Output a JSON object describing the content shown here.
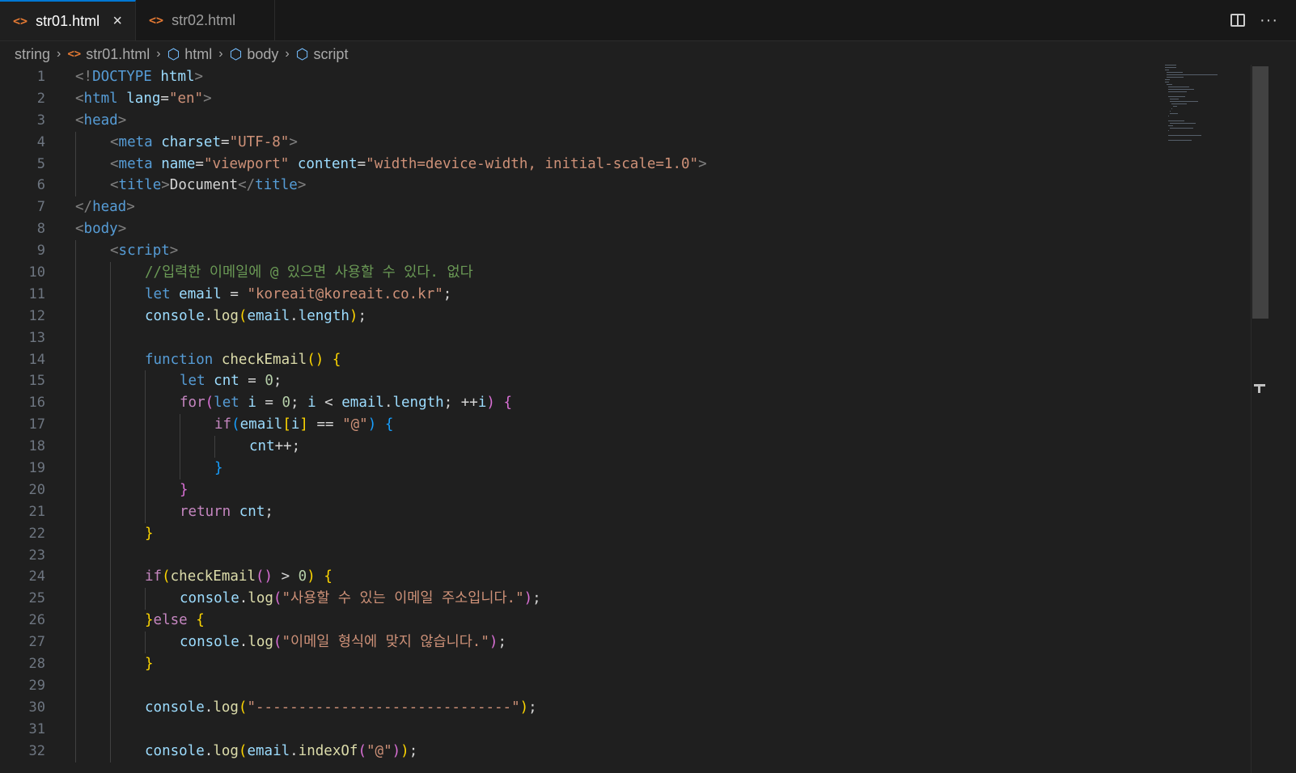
{
  "tabs": [
    {
      "label": "str01.html",
      "active": true,
      "icon": "html-file-icon"
    },
    {
      "label": "str02.html",
      "active": false,
      "icon": "html-file-icon"
    }
  ],
  "breadcrumb": [
    "string",
    "str01.html",
    "html",
    "body",
    "script"
  ],
  "icons": {
    "file": "<>",
    "close": "×",
    "chevron": "›",
    "symbol": "⬡",
    "more": "···"
  },
  "colors": {
    "background": "#1f1f1f",
    "tab_accent": "#0078d4",
    "html_icon": "#e37933",
    "symbol_icon": "#75beff"
  },
  "lines": [
    {
      "n": "1",
      "indent": 0,
      "t": [
        [
          "t-tag",
          "<!"
        ],
        [
          "t-el",
          "DOCTYPE"
        ],
        [
          "t-txt",
          " "
        ],
        [
          "t-at",
          "html"
        ],
        [
          "t-tag",
          ">"
        ]
      ]
    },
    {
      "n": "2",
      "indent": 0,
      "t": [
        [
          "t-tag",
          "<"
        ],
        [
          "t-el",
          "html"
        ],
        [
          "t-txt",
          " "
        ],
        [
          "t-at",
          "lang"
        ],
        [
          "t-pun",
          "="
        ],
        [
          "t-str",
          "\"en\""
        ],
        [
          "t-tag",
          ">"
        ]
      ]
    },
    {
      "n": "3",
      "indent": 0,
      "t": [
        [
          "t-tag",
          "<"
        ],
        [
          "t-el",
          "head"
        ],
        [
          "t-tag",
          ">"
        ]
      ]
    },
    {
      "n": "4",
      "indent": 1,
      "t": [
        [
          "t-tag",
          "<"
        ],
        [
          "t-el",
          "meta"
        ],
        [
          "t-txt",
          " "
        ],
        [
          "t-at",
          "charset"
        ],
        [
          "t-pun",
          "="
        ],
        [
          "t-str",
          "\"UTF-8\""
        ],
        [
          "t-tag",
          ">"
        ]
      ]
    },
    {
      "n": "5",
      "indent": 1,
      "t": [
        [
          "t-tag",
          "<"
        ],
        [
          "t-el",
          "meta"
        ],
        [
          "t-txt",
          " "
        ],
        [
          "t-at",
          "name"
        ],
        [
          "t-pun",
          "="
        ],
        [
          "t-str",
          "\"viewport\""
        ],
        [
          "t-txt",
          " "
        ],
        [
          "t-at",
          "content"
        ],
        [
          "t-pun",
          "="
        ],
        [
          "t-str",
          "\"width=device-width, initial-scale=1.0\""
        ],
        [
          "t-tag",
          ">"
        ]
      ]
    },
    {
      "n": "6",
      "indent": 1,
      "t": [
        [
          "t-tag",
          "<"
        ],
        [
          "t-el",
          "title"
        ],
        [
          "t-tag",
          ">"
        ],
        [
          "t-txt",
          "Document"
        ],
        [
          "t-tag",
          "</"
        ],
        [
          "t-el",
          "title"
        ],
        [
          "t-tag",
          ">"
        ]
      ]
    },
    {
      "n": "7",
      "indent": 0,
      "t": [
        [
          "t-tag",
          "</"
        ],
        [
          "t-el",
          "head"
        ],
        [
          "t-tag",
          ">"
        ]
      ]
    },
    {
      "n": "8",
      "indent": 0,
      "t": [
        [
          "t-tag",
          "<"
        ],
        [
          "t-el",
          "body"
        ],
        [
          "t-tag",
          ">"
        ]
      ]
    },
    {
      "n": "9",
      "indent": 1,
      "t": [
        [
          "t-tag",
          "<"
        ],
        [
          "t-el",
          "script"
        ],
        [
          "t-tag",
          ">"
        ]
      ]
    },
    {
      "n": "10",
      "indent": 2,
      "t": [
        [
          "t-cm",
          "//입력한 이메일에 @ 있으면 사용할 수 있다. 없다"
        ]
      ]
    },
    {
      "n": "11",
      "indent": 2,
      "t": [
        [
          "t-kw",
          "let"
        ],
        [
          "t-txt",
          " "
        ],
        [
          "t-var",
          "email"
        ],
        [
          "t-pun",
          " = "
        ],
        [
          "t-str",
          "\"koreait@koreait.co.kr\""
        ],
        [
          "t-pun",
          ";"
        ]
      ]
    },
    {
      "n": "12",
      "indent": 2,
      "t": [
        [
          "t-var",
          "console"
        ],
        [
          "t-pun",
          "."
        ],
        [
          "t-fn",
          "log"
        ],
        [
          "t-b1",
          "("
        ],
        [
          "t-var",
          "email"
        ],
        [
          "t-pun",
          "."
        ],
        [
          "t-var",
          "length"
        ],
        [
          "t-b1",
          ")"
        ],
        [
          "t-pun",
          ";"
        ]
      ]
    },
    {
      "n": "13",
      "indent": 2,
      "t": []
    },
    {
      "n": "14",
      "indent": 2,
      "t": [
        [
          "t-kw",
          "function"
        ],
        [
          "t-txt",
          " "
        ],
        [
          "t-fn",
          "checkEmail"
        ],
        [
          "t-b1",
          "()"
        ],
        [
          "t-txt",
          " "
        ],
        [
          "t-b1",
          "{"
        ]
      ]
    },
    {
      "n": "15",
      "indent": 3,
      "t": [
        [
          "t-kw",
          "let"
        ],
        [
          "t-txt",
          " "
        ],
        [
          "t-var",
          "cnt"
        ],
        [
          "t-pun",
          " = "
        ],
        [
          "t-num",
          "0"
        ],
        [
          "t-pun",
          ";"
        ]
      ]
    },
    {
      "n": "16",
      "indent": 3,
      "t": [
        [
          "t-ctl",
          "for"
        ],
        [
          "t-b2",
          "("
        ],
        [
          "t-kw",
          "let"
        ],
        [
          "t-txt",
          " "
        ],
        [
          "t-var",
          "i"
        ],
        [
          "t-pun",
          " = "
        ],
        [
          "t-num",
          "0"
        ],
        [
          "t-pun",
          "; "
        ],
        [
          "t-var",
          "i"
        ],
        [
          "t-pun",
          " < "
        ],
        [
          "t-var",
          "email"
        ],
        [
          "t-pun",
          "."
        ],
        [
          "t-var",
          "length"
        ],
        [
          "t-pun",
          "; ++"
        ],
        [
          "t-var",
          "i"
        ],
        [
          "t-b2",
          ")"
        ],
        [
          "t-txt",
          " "
        ],
        [
          "t-b2",
          "{"
        ]
      ]
    },
    {
      "n": "17",
      "indent": 4,
      "t": [
        [
          "t-ctl",
          "if"
        ],
        [
          "t-b3",
          "("
        ],
        [
          "t-var",
          "email"
        ],
        [
          "t-b1",
          "["
        ],
        [
          "t-var",
          "i"
        ],
        [
          "t-b1",
          "]"
        ],
        [
          "t-pun",
          " == "
        ],
        [
          "t-str",
          "\"@\""
        ],
        [
          "t-b3",
          ")"
        ],
        [
          "t-txt",
          " "
        ],
        [
          "t-b3",
          "{"
        ]
      ]
    },
    {
      "n": "18",
      "indent": 5,
      "t": [
        [
          "t-var",
          "cnt"
        ],
        [
          "t-pun",
          "++;"
        ]
      ]
    },
    {
      "n": "19",
      "indent": 4,
      "t": [
        [
          "t-b3",
          "}"
        ]
      ]
    },
    {
      "n": "20",
      "indent": 3,
      "t": [
        [
          "t-b2",
          "}"
        ]
      ]
    },
    {
      "n": "21",
      "indent": 3,
      "t": [
        [
          "t-ctl",
          "return"
        ],
        [
          "t-txt",
          " "
        ],
        [
          "t-var",
          "cnt"
        ],
        [
          "t-pun",
          ";"
        ]
      ]
    },
    {
      "n": "22",
      "indent": 2,
      "t": [
        [
          "t-b1",
          "}"
        ]
      ]
    },
    {
      "n": "23",
      "indent": 2,
      "t": []
    },
    {
      "n": "24",
      "indent": 2,
      "t": [
        [
          "t-ctl",
          "if"
        ],
        [
          "t-b1",
          "("
        ],
        [
          "t-fn",
          "checkEmail"
        ],
        [
          "t-b2",
          "()"
        ],
        [
          "t-pun",
          " > "
        ],
        [
          "t-num",
          "0"
        ],
        [
          "t-b1",
          ")"
        ],
        [
          "t-txt",
          " "
        ],
        [
          "t-b1",
          "{"
        ]
      ]
    },
    {
      "n": "25",
      "indent": 3,
      "t": [
        [
          "t-var",
          "console"
        ],
        [
          "t-pun",
          "."
        ],
        [
          "t-fn",
          "log"
        ],
        [
          "t-b2",
          "("
        ],
        [
          "t-str",
          "\"사용할 수 있는 이메일 주소입니다.\""
        ],
        [
          "t-b2",
          ")"
        ],
        [
          "t-pun",
          ";"
        ]
      ]
    },
    {
      "n": "26",
      "indent": 2,
      "t": [
        [
          "t-b1",
          "}"
        ],
        [
          "t-ctl",
          "else"
        ],
        [
          "t-txt",
          " "
        ],
        [
          "t-b1",
          "{"
        ]
      ]
    },
    {
      "n": "27",
      "indent": 3,
      "t": [
        [
          "t-var",
          "console"
        ],
        [
          "t-pun",
          "."
        ],
        [
          "t-fn",
          "log"
        ],
        [
          "t-b2",
          "("
        ],
        [
          "t-str",
          "\"이메일 형식에 맞지 않습니다.\""
        ],
        [
          "t-b2",
          ")"
        ],
        [
          "t-pun",
          ";"
        ]
      ]
    },
    {
      "n": "28",
      "indent": 2,
      "t": [
        [
          "t-b1",
          "}"
        ]
      ]
    },
    {
      "n": "29",
      "indent": 2,
      "t": []
    },
    {
      "n": "30",
      "indent": 2,
      "t": [
        [
          "t-var",
          "console"
        ],
        [
          "t-pun",
          "."
        ],
        [
          "t-fn",
          "log"
        ],
        [
          "t-b1",
          "("
        ],
        [
          "t-str",
          "\"------------------------------\""
        ],
        [
          "t-b1",
          ")"
        ],
        [
          "t-pun",
          ";"
        ]
      ]
    },
    {
      "n": "31",
      "indent": 2,
      "t": []
    },
    {
      "n": "32",
      "indent": 2,
      "t": [
        [
          "t-var",
          "console"
        ],
        [
          "t-pun",
          "."
        ],
        [
          "t-fn",
          "log"
        ],
        [
          "t-b1",
          "("
        ],
        [
          "t-var",
          "email"
        ],
        [
          "t-pun",
          "."
        ],
        [
          "t-fn",
          "indexOf"
        ],
        [
          "t-b2",
          "("
        ],
        [
          "t-str",
          "\"@\""
        ],
        [
          "t-b2",
          ")"
        ],
        [
          "t-b1",
          ")"
        ],
        [
          "t-pun",
          ";"
        ]
      ]
    }
  ]
}
